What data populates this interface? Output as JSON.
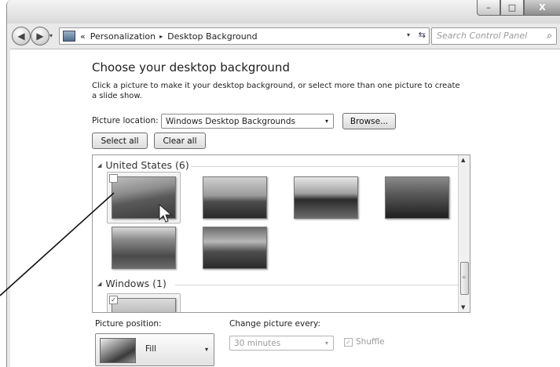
{
  "window": {
    "caption_minimize": "–",
    "caption_maximize": "□",
    "caption_close": "X"
  },
  "navbar": {
    "back_glyph": "◀",
    "forward_glyph": "▶",
    "history_glyph": "▾",
    "overflow": "«",
    "breadcrumb": [
      "Personalization",
      "Desktop Background"
    ],
    "breadcrumb_separator": "▸",
    "dropdown_glyph": "▾",
    "refresh_glyph": "⇆",
    "search_placeholder": "Search Control Panel",
    "search_glyph": "⌕"
  },
  "page": {
    "heading": "Choose your desktop background",
    "description": "Click a picture to make it your desktop background, or select more than one picture to create a slide show.",
    "location_label": "Picture location:",
    "location_value": "Windows Desktop Backgrounds",
    "location_arrow": "▾",
    "browse_label": "Browse...",
    "select_all_label": "Select all",
    "clear_all_label": "Clear all"
  },
  "gallery": {
    "groups": [
      {
        "title": "United States (6)",
        "expanded": true,
        "thumbnail_count": 6
      },
      {
        "title": "Windows (1)",
        "expanded": true,
        "thumbnail_count": 1
      }
    ],
    "collapse_glyph": "◢",
    "checked_glyph": "✓",
    "scroll_up": "▲",
    "scroll_down": "▼"
  },
  "bottom": {
    "position_label": "Picture position:",
    "position_value": "Fill",
    "position_arrow": "▾",
    "interval_label": "Change picture every:",
    "interval_value": "30 minutes",
    "interval_arrow": "▾",
    "shuffle_label": "Shuffle",
    "shuffle_checked": true
  }
}
